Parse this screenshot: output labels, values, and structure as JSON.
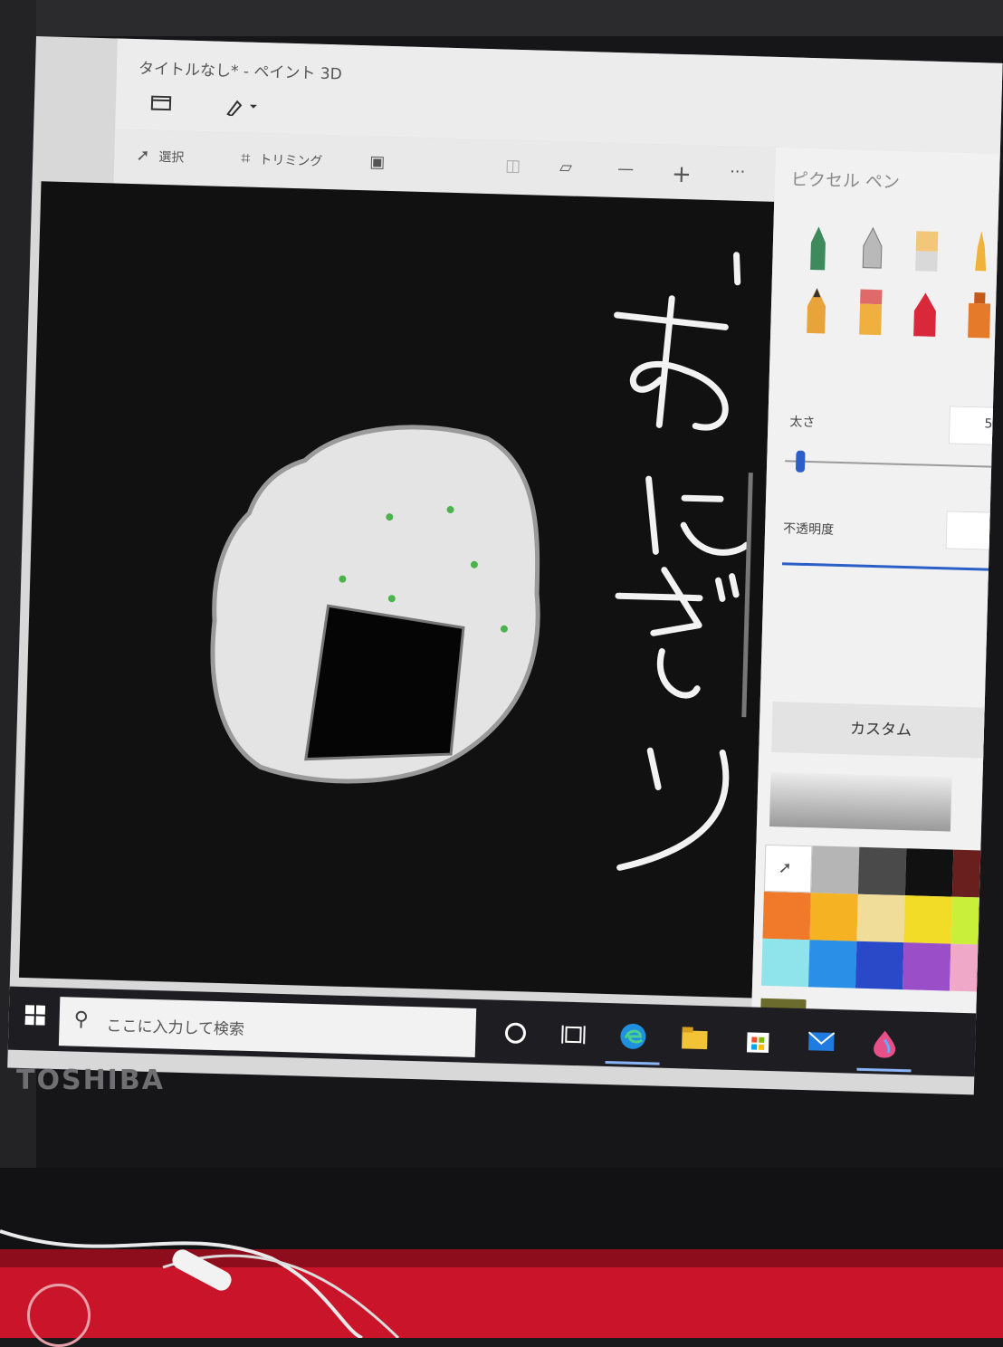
{
  "window": {
    "title": "タイトルなし* - ペイント 3D"
  },
  "toolbar": {
    "select_label": "選択",
    "crop_label": "トリミング",
    "zoom_out": "—",
    "zoom_in": "+",
    "more": "···"
  },
  "side_panel": {
    "title": "ピクセル ペン",
    "thickness_label": "太さ",
    "thickness_value": "5",
    "opacity_label": "不透明度",
    "custom_button": "カスタム",
    "add_color": "+",
    "current_color": "#6b6b2e",
    "palette": [
      "#ffffff",
      "#b5b5b5",
      "#4a4a4a",
      "#111111",
      "#6a1f1f",
      "#f07a2a",
      "#f5b324",
      "#f0dd9a",
      "#f3dc28",
      "#c9ef3a",
      "#8fe3ea",
      "#2a8fe6",
      "#2a49c9",
      "#9a4fc9",
      "#f0a8c8"
    ]
  },
  "canvas": {
    "drawing_text": "おにぎり"
  },
  "taskbar": {
    "search_placeholder": "ここに入力して検索"
  },
  "device": {
    "brand": "TOSHIBA"
  }
}
